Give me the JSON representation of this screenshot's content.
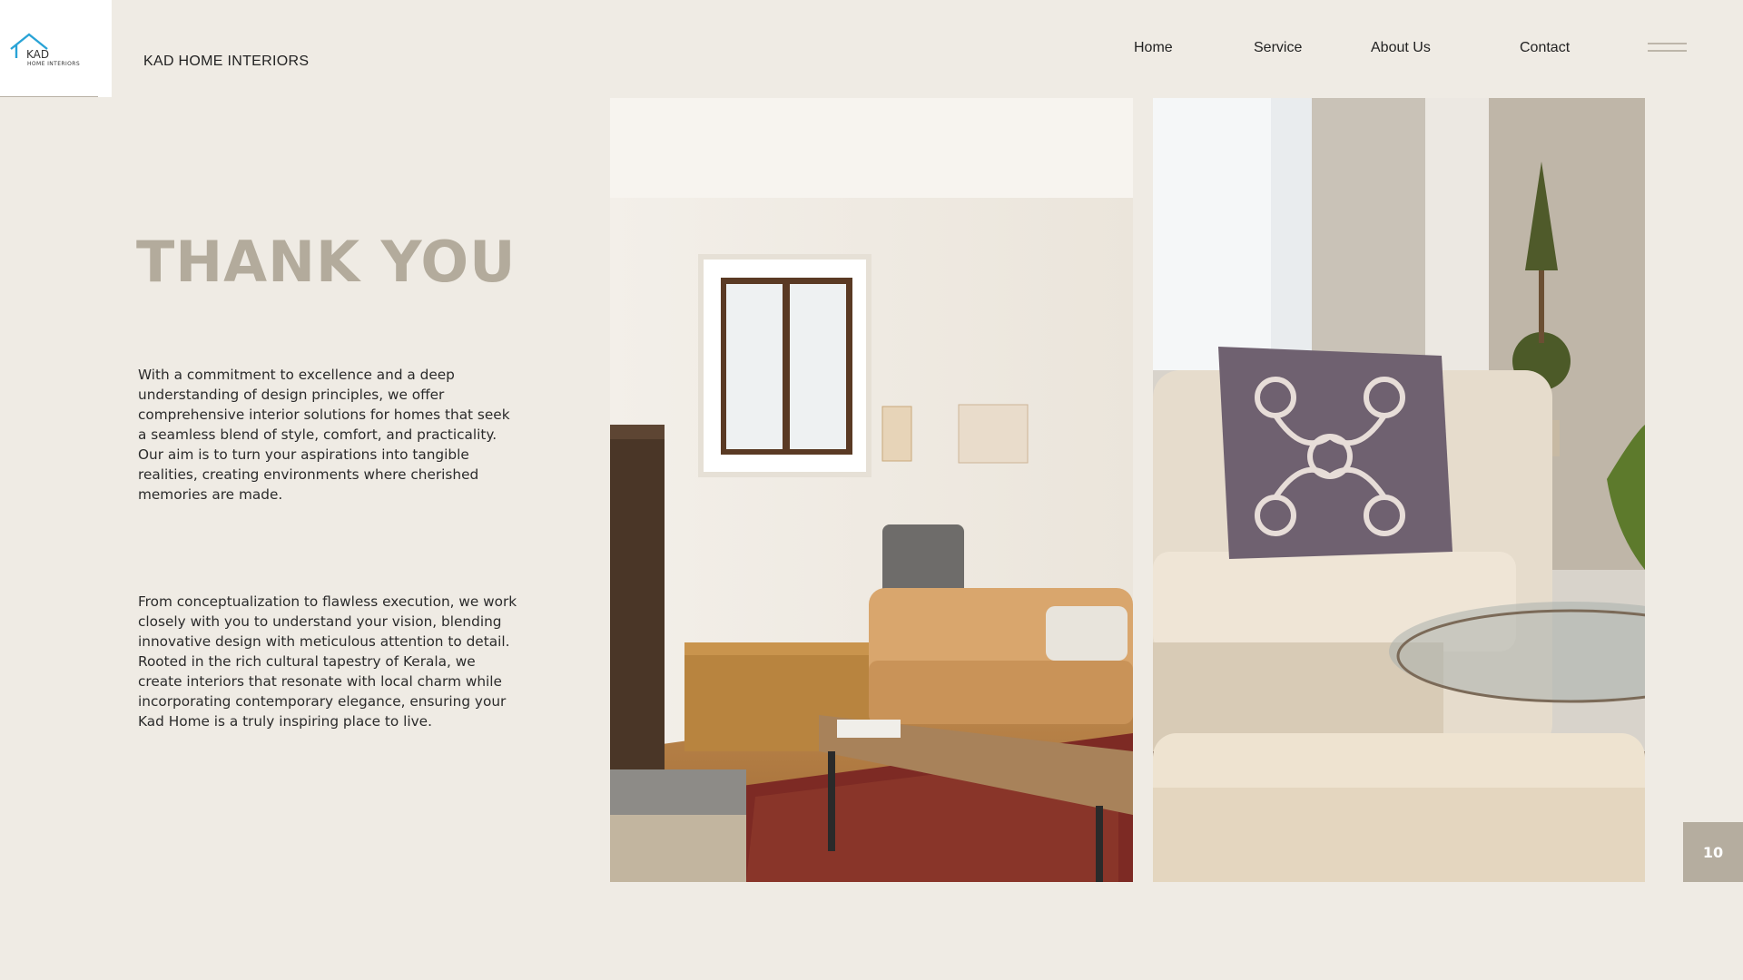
{
  "brand": {
    "logo_text": "KAD",
    "logo_subtext": "HOME INTERIORS",
    "name": "KAD HOME INTERIORS",
    "accent_color": "#29a3d6"
  },
  "nav": {
    "items": [
      "Home",
      "Service",
      "About Us",
      "Contact"
    ],
    "menu_icon": "hamburger-icon"
  },
  "hero": {
    "title": "THANK YOU",
    "paragraphs": [
      "With a commitment to excellence and a deep understanding of design principles, we offer comprehensive interior solutions for homes that seek a seamless blend of style, comfort, and practicality. Our aim is to turn your aspirations into tangible realities, creating environments where cherished memories are made.",
      "From conceptualization to flawless execution, we work closely with you to understand your vision, blending innovative design with meticulous attention to detail. Rooted in the rich cultural tapestry of Kerala, we create interiors that resonate with local charm while incorporating contemporary elegance, ensuring your Kad Home is a truly inspiring place to live."
    ]
  },
  "page_number": "10",
  "colors": {
    "background": "#efebe4",
    "title": "#b3ab9c",
    "badge": "#b5ad9f"
  }
}
